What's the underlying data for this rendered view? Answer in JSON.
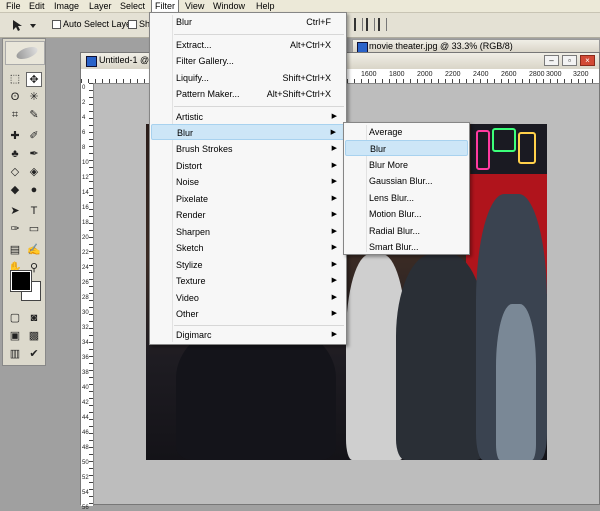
{
  "menubar": {
    "items": [
      "File",
      "Edit",
      "Image",
      "Layer",
      "Select",
      "Filter",
      "View",
      "Window",
      "Help"
    ],
    "active": "Filter"
  },
  "options": {
    "auto_select_layer": "Auto Select Layer",
    "show_truncated": "Sho"
  },
  "document": {
    "title": "Untitled-1 @",
    "second_title": "movie theater.jpg @ 33.3% (RGB/8)",
    "ruler_labels": [
      "1600",
      "1800",
      "2000",
      "2200",
      "2400",
      "2600",
      "2800",
      "3000",
      "3200"
    ],
    "vruler_labels": [
      "0",
      "2",
      "4",
      "6",
      "8",
      "10",
      "12",
      "14",
      "16",
      "18",
      "20",
      "22",
      "24",
      "26",
      "28",
      "30",
      "32",
      "34",
      "36",
      "38",
      "40",
      "42",
      "44",
      "46",
      "48",
      "50",
      "52",
      "54",
      "56"
    ]
  },
  "filter_menu": {
    "items": [
      {
        "label": "Blur",
        "shortcut": "Ctrl+F",
        "arrow": ""
      },
      {
        "label": "Extract...",
        "shortcut": "Alt+Ctrl+X",
        "arrow": ""
      },
      {
        "label": "Filter Gallery...",
        "shortcut": "",
        "arrow": ""
      },
      {
        "label": "Liquify...",
        "shortcut": "Shift+Ctrl+X",
        "arrow": ""
      },
      {
        "label": "Pattern Maker...",
        "shortcut": "Alt+Shift+Ctrl+X",
        "arrow": ""
      },
      {
        "label": "Artistic",
        "shortcut": "",
        "arrow": "▶"
      },
      {
        "label": "Blur",
        "shortcut": "",
        "arrow": "▶"
      },
      {
        "label": "Brush Strokes",
        "shortcut": "",
        "arrow": "▶"
      },
      {
        "label": "Distort",
        "shortcut": "",
        "arrow": "▶"
      },
      {
        "label": "Noise",
        "shortcut": "",
        "arrow": "▶"
      },
      {
        "label": "Pixelate",
        "shortcut": "",
        "arrow": "▶"
      },
      {
        "label": "Render",
        "shortcut": "",
        "arrow": "▶"
      },
      {
        "label": "Sharpen",
        "shortcut": "",
        "arrow": "▶"
      },
      {
        "label": "Sketch",
        "shortcut": "",
        "arrow": "▶"
      },
      {
        "label": "Stylize",
        "shortcut": "",
        "arrow": "▶"
      },
      {
        "label": "Texture",
        "shortcut": "",
        "arrow": "▶"
      },
      {
        "label": "Video",
        "shortcut": "",
        "arrow": "▶"
      },
      {
        "label": "Other",
        "shortcut": "",
        "arrow": "▶"
      },
      {
        "label": "Digimarc",
        "shortcut": "",
        "arrow": "▶"
      }
    ]
  },
  "blur_submenu": {
    "items": [
      "Average",
      "Blur",
      "Blur More",
      "Gaussian Blur...",
      "Lens Blur...",
      "Motion Blur...",
      "Radial Blur...",
      "Smart Blur..."
    ],
    "highlighted": "Blur"
  },
  "colors": {
    "highlight": "#cde6f7",
    "menubar": "#ece9d8"
  }
}
